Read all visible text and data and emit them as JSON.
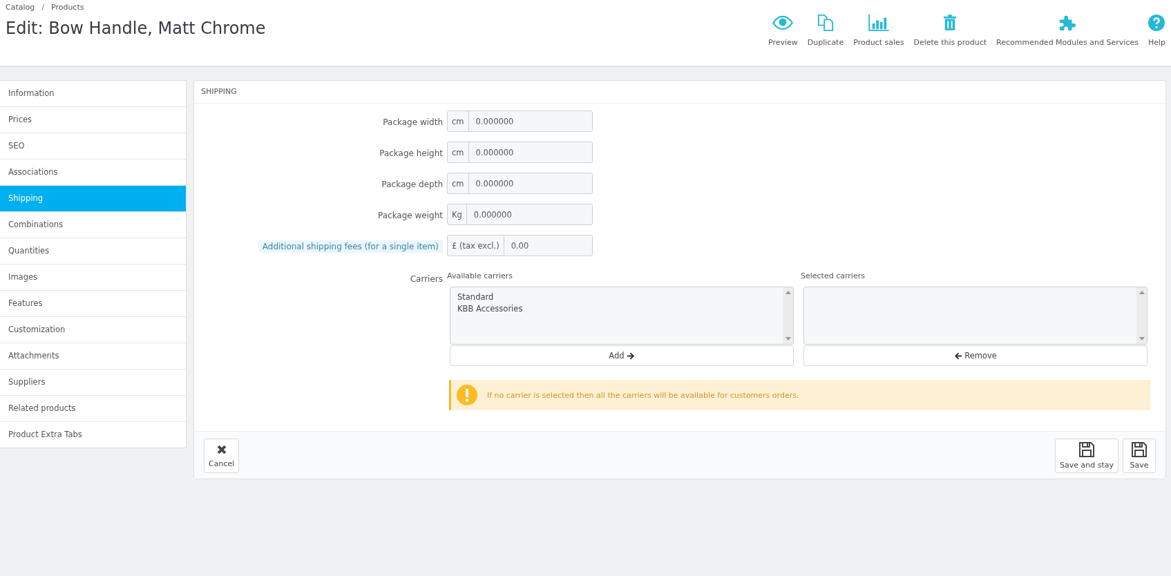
{
  "breadcrumb": [
    "Catalog",
    "Products"
  ],
  "breadcrumb_separator": "/",
  "page_title": "Edit: Bow Handle, Matt Chrome",
  "toolbar": [
    {
      "label": "Preview"
    },
    {
      "label": "Duplicate"
    },
    {
      "label": "Product sales"
    },
    {
      "label": "Delete this product"
    },
    {
      "label": "Recommended Modules and Services"
    },
    {
      "label": "Help"
    }
  ],
  "sidebar": {
    "items": [
      {
        "label": "Information",
        "selected": false
      },
      {
        "label": "Prices",
        "selected": false
      },
      {
        "label": "SEO",
        "selected": false
      },
      {
        "label": "Associations",
        "selected": false
      },
      {
        "label": "Shipping",
        "selected": true
      },
      {
        "label": "Combinations",
        "selected": false
      },
      {
        "label": "Quantities",
        "selected": false
      },
      {
        "label": "Images",
        "selected": false
      },
      {
        "label": "Features",
        "selected": false
      },
      {
        "label": "Customization",
        "selected": false
      },
      {
        "label": "Attachments",
        "selected": false
      },
      {
        "label": "Suppliers",
        "selected": false
      },
      {
        "label": "Related products",
        "selected": false
      },
      {
        "label": "Product Extra Tabs",
        "selected": false
      }
    ]
  },
  "panel": {
    "heading": "SHIPPING",
    "fields": [
      {
        "label": "Package width",
        "unit": "cm",
        "value": "0.000000",
        "has_help": false
      },
      {
        "label": "Package height",
        "unit": "cm",
        "value": "0.000000",
        "has_help": false
      },
      {
        "label": "Package depth",
        "unit": "cm",
        "value": "0.000000",
        "has_help": false
      },
      {
        "label": "Package weight",
        "unit": "Kg",
        "value": "0.000000",
        "has_help": false
      },
      {
        "label": "Additional shipping fees (for a single item)",
        "unit": "£ (tax excl.)",
        "value": "0.00",
        "has_help": true
      }
    ],
    "carriers": {
      "label": "Carriers",
      "available": {
        "title": "Available carriers",
        "items": [
          "Standard",
          "KBB Accessories"
        ],
        "button": "Add"
      },
      "selected": {
        "title": "Selected carriers",
        "button": "Remove"
      }
    },
    "warning": "If no carrier is selected then all the carriers will be available for customers orders.",
    "footer": {
      "cancel": "Cancel",
      "save_and_stay": "Save and stay",
      "save": "Save"
    }
  }
}
